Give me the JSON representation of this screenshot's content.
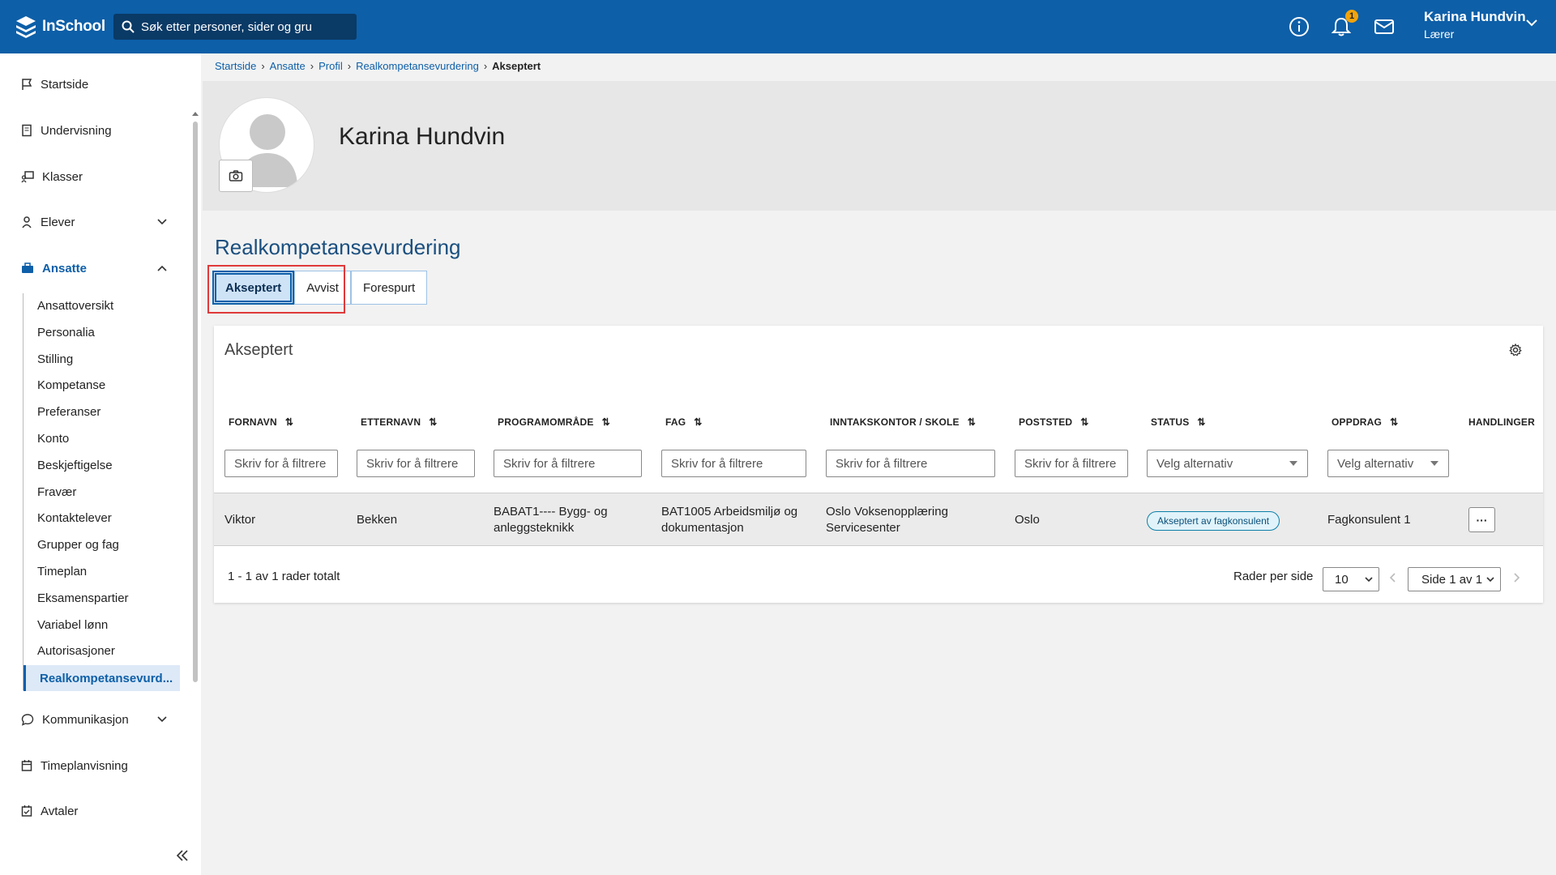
{
  "app": {
    "logo_text": "InSchool"
  },
  "search": {
    "placeholder": "Søk etter personer, sider og gru"
  },
  "header": {
    "notification_count": "1",
    "user_name": "Karina Hundvin",
    "user_role": "Lærer"
  },
  "sidebar": {
    "items": [
      {
        "label": "Startside",
        "icon": "flag-icon"
      },
      {
        "label": "Undervisning",
        "icon": "book-icon"
      },
      {
        "label": "Klasser",
        "icon": "classroom-icon"
      },
      {
        "label": "Elever",
        "icon": "students-icon"
      },
      {
        "label": "Ansatte",
        "icon": "briefcase-icon"
      },
      {
        "label": "Kommunikasjon",
        "icon": "chat-icon"
      },
      {
        "label": "Timeplanvisning",
        "icon": "calendar-icon"
      },
      {
        "label": "Avtaler",
        "icon": "calendar-check-icon"
      }
    ],
    "sub_items": [
      "Ansattoversikt",
      "Personalia",
      "Stilling",
      "Kompetanse",
      "Preferanser",
      "Konto",
      "Beskjeftigelse",
      "Fravær",
      "Kontaktelever",
      "Grupper og fag",
      "Timeplan",
      "Eksamenspartier",
      "Variabel lønn",
      "Autorisasjoner",
      "Realkompetansevurd..."
    ]
  },
  "breadcrumb": {
    "items": [
      "Startside",
      "Ansatte",
      "Profil",
      "Realkompetansevurdering"
    ],
    "current": "Akseptert"
  },
  "profile": {
    "name": "Karina Hundvin"
  },
  "page": {
    "title": "Realkompetansevurdering"
  },
  "tabs": [
    "Akseptert",
    "Avvist",
    "Forespurt"
  ],
  "table": {
    "title": "Akseptert",
    "columns": [
      "FORNAVN",
      "ETTERNAVN",
      "PROGRAMOMRÅDE",
      "FAG",
      "INNTAKSKONTOR / SKOLE",
      "POSTSTED",
      "STATUS",
      "OPPDRAG",
      "HANDLINGER"
    ],
    "filter_placeholders": {
      "fornavn": "Skriv for å filtrere",
      "etternavn": "Skriv for å filtrere",
      "programomrade": "Skriv for å filtrere",
      "fag": "Skriv for å filtrere",
      "skole": "Skriv for å filtrere",
      "poststed": "Skriv for å filtrere"
    },
    "select_placeholders": {
      "status": "Velg alternativ",
      "oppdrag": "Velg alternativ"
    },
    "rows": [
      {
        "fornavn": "Viktor",
        "etternavn": "Bekken",
        "programomrade_line1": "BABAT1---- Bygg- og",
        "programomrade_line2": "anleggsteknikk",
        "fag_line1": "BAT1005 Arbeidsmiljø og",
        "fag_line2": "dokumentasjon",
        "skole_line1": "Oslo Voksenopplæring",
        "skole_line2": "Servicesenter",
        "poststed": "Oslo",
        "status": "Akseptert av fagkonsulent",
        "oppdrag": "Fagkonsulent 1",
        "actions": "···"
      }
    ],
    "footer": {
      "summary": "1 - 1 av 1 rader totalt",
      "rows_per_page_label": "Rader per side",
      "rows_per_page": "10",
      "page": "Side 1 av 1"
    }
  },
  "colors": {
    "header_bg": "#0d5fa8",
    "accent": "#0d5fa8",
    "highlight": "#e0393a",
    "badge": "#f3a40b"
  }
}
